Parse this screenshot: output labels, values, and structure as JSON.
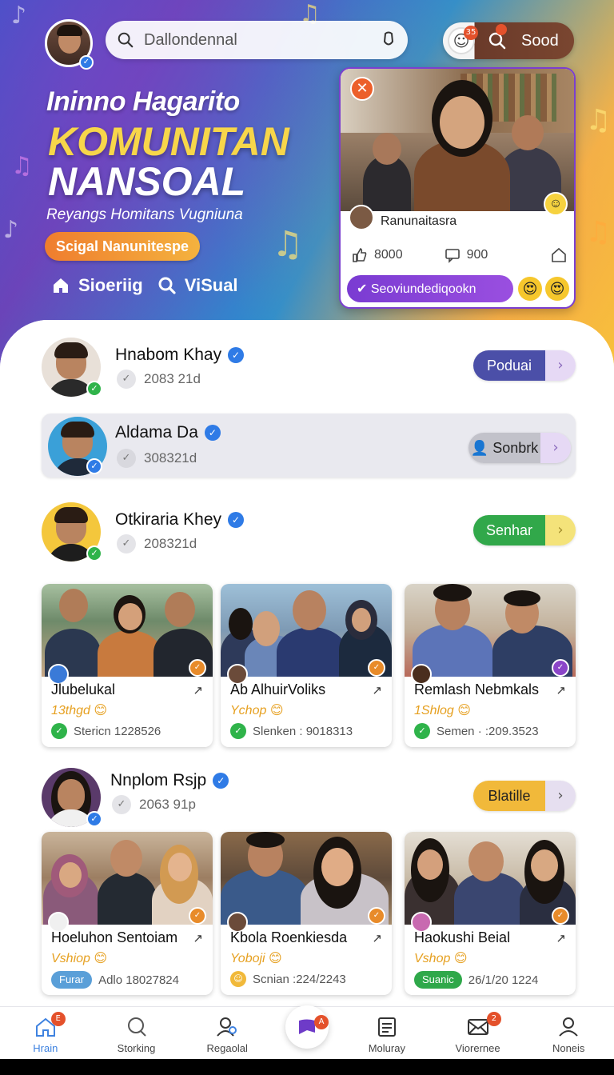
{
  "header": {
    "search_placeholder": "Dallondennal",
    "sood_badge": "35",
    "sood_label": "Sood"
  },
  "hero": {
    "line1": "Ininno Hagarito",
    "line2": "KOMUNITAN",
    "line3": "NANSOAL",
    "subtitle": "Reyangs Homitans Vugniuna",
    "pill": "Scigal Nanunitespe",
    "link1": "Sioeriig",
    "link2": "ViSual"
  },
  "featured": {
    "author": "Ranunaitasra",
    "likes": "8000",
    "comments": "900",
    "cta": "Seoviundediqookn"
  },
  "people": [
    {
      "name": "Hnabom Khay",
      "meta": "2083 21d",
      "button": "Poduai",
      "btn_color": "#4b4fa8",
      "arrow_bg": "#e6d9f5"
    },
    {
      "name": "Aldama Da",
      "meta": "308321d",
      "button": "Sonbrk",
      "btn_color": "#b8b8c2",
      "arrow_bg": "#e6d9f5"
    },
    {
      "name": "Otkiraria Khey",
      "meta": "208321d",
      "button": "Senhar",
      "btn_color": "#31a84a",
      "arrow_bg": "#f4e37a"
    },
    {
      "name": "Nnplom Rsjp",
      "meta": "2063 91p",
      "button": "Blatille",
      "btn_color": "#f1b93a",
      "arrow_bg": "#e6dff0"
    }
  ],
  "cards_row1": [
    {
      "title": "Jlubelukal",
      "tag": "13thgd",
      "foot": "Stericn 1228526"
    },
    {
      "title": "Ab AlhuirVoliks",
      "tag": "Ychop",
      "foot": "Slenken : 9018313"
    },
    {
      "title": "Remlash Nebmkals",
      "tag": "1Shlog",
      "foot": "Semen · :209.3523"
    }
  ],
  "cards_row2": [
    {
      "title": "Hoeluhon Sentoiam",
      "tag": "Vshiop",
      "badge": "Furar",
      "foot": "Adlo 18027824"
    },
    {
      "title": "Kbola Roenkiesda",
      "tag": "Yoboji",
      "foot": "Scnian :224/2243"
    },
    {
      "title": "Haokushi Beial",
      "tag": "Vshop",
      "badge": "Suanic",
      "foot": "26/1/20 1224"
    }
  ],
  "nav": {
    "home": "Hrain",
    "home_badge": "E",
    "storking": "Storking",
    "regaolal": "Regaolal",
    "center_badge": "A",
    "moluray": "Moluray",
    "viorernee": "Viorernee",
    "viorernee_badge": "2",
    "noneis": "Noneis"
  },
  "colors": {
    "accent_purple": "#7a3bd2",
    "verify_blue": "#2f7be6",
    "online_green": "#2fb34a",
    "badge_orange": "#e4512b"
  }
}
